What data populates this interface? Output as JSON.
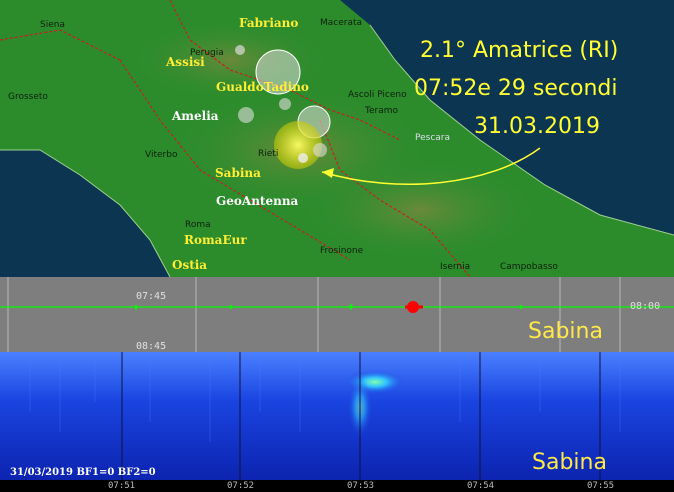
{
  "event": {
    "magnitude_location": "2.1° Amatrice (RI)",
    "time": "07:52e 29 secondi",
    "date": "31.03.2019"
  },
  "towns": {
    "siena": "Siena",
    "macerata": "Macerata",
    "perugia": "Perugia",
    "grosseto": "Grosseto",
    "ascoli": "Ascoli Piceno",
    "teramo": "Teramo",
    "pescara": "Pescara",
    "viterbo": "Viterbo",
    "rieti": "Rieti",
    "roma": "Roma",
    "frosinone": "Frosinone",
    "isernia": "Isernia",
    "campobasso": "Campobasso"
  },
  "stations": {
    "fabriano": "Fabriano",
    "assisi": "Assisi",
    "gualdo": "GualdoTadino",
    "amelia": "Amelia",
    "sabina": "Sabina",
    "geoantenna": "GeoAntenna",
    "romaeur": "RomaEur",
    "ostia": "Ostia"
  },
  "seismogram": {
    "label_start": "07:45",
    "label_end": "08:00",
    "label_next": "08:45",
    "station": "Sabina"
  },
  "spectrogram": {
    "status": "31/03/2019 BF1=0 BF2=0",
    "station": "Sabina",
    "ticks": [
      "07:51",
      "07:52",
      "07:53",
      "07:54",
      "07:55"
    ]
  },
  "colors": {
    "event_text": "#ffff33",
    "station_yellow": "#ffee33",
    "trace": "#00ff00",
    "event_marker": "#ff0000",
    "spectrogram_bg": "#1030c8"
  }
}
